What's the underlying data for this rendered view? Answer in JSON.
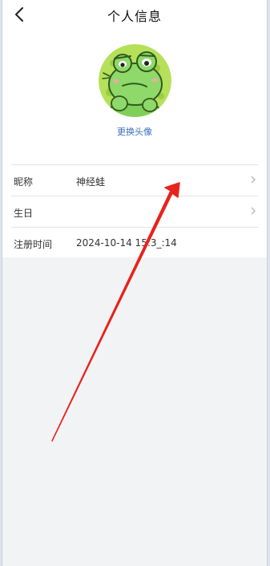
{
  "header": {
    "title": "个人信息",
    "back_icon": "chevron-left-icon"
  },
  "avatar": {
    "icon": "frog-avatar",
    "change_label": "更换头像"
  },
  "fields": {
    "nickname": {
      "label": "昵称",
      "value": "神经蛙"
    },
    "birthday": {
      "label": "生日",
      "value": ""
    },
    "registered": {
      "label": "注册时间",
      "value": "2024-10-14 15:3_:14"
    }
  },
  "colors": {
    "accent_link": "#3a6fb8",
    "annotation_arrow": "#e8231b",
    "page_bg": "#f2f3f5"
  }
}
